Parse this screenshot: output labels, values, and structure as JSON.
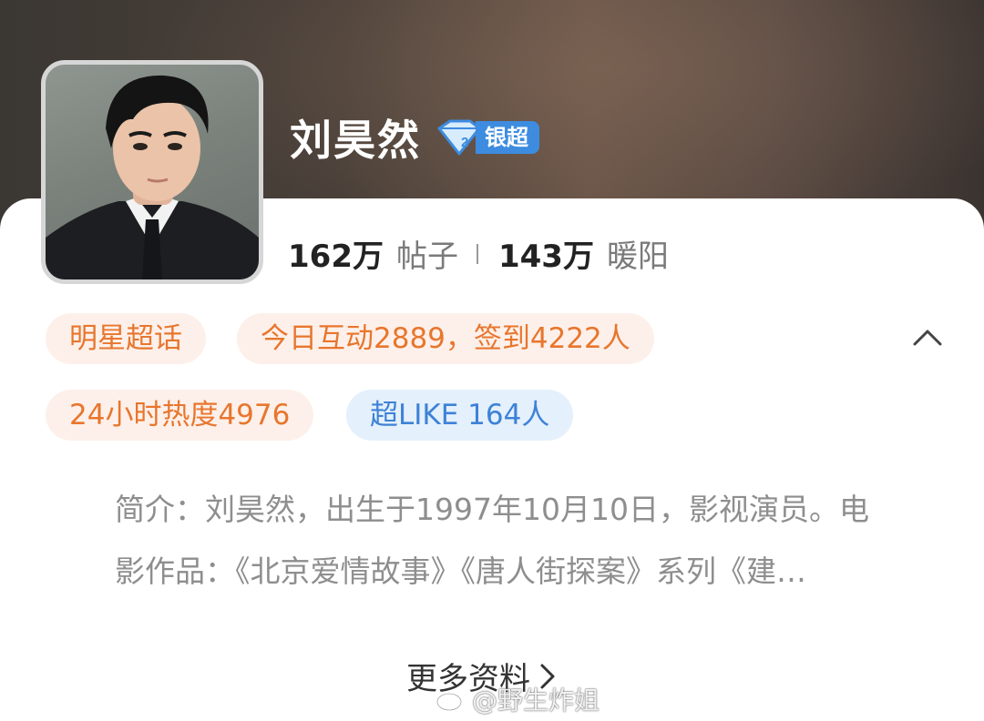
{
  "profile": {
    "name": "刘昊然",
    "badge_label": "银超",
    "posts_count": "162万",
    "posts_label": "帖子",
    "fans_count": "143万",
    "fans_label": "暖阳"
  },
  "tags": {
    "category": "明星超话",
    "today": "今日互动2889，签到4222人",
    "heat": "24小时热度4976",
    "like": "超LIKE 164人"
  },
  "intro": {
    "line1": "简介：刘昊然，出生于1997年10月10日，影视演员。电",
    "line2": "影作品：《北京爱情故事》《唐人街探案》系列《建…"
  },
  "more_label": "更多资料",
  "watermark": "@野生炸姐",
  "icons": {
    "badge": "silver-diamond-icon",
    "collapse": "chevron-up-icon",
    "more": "chevron-right-icon",
    "watermark": "weibo-icon"
  },
  "colors": {
    "tag_orange_text": "#e8762d",
    "tag_orange_bg": "#fdf0ea",
    "tag_blue_text": "#3d82d6",
    "tag_blue_bg": "#e4f0fc",
    "badge_blue": "#3d8ce0"
  }
}
